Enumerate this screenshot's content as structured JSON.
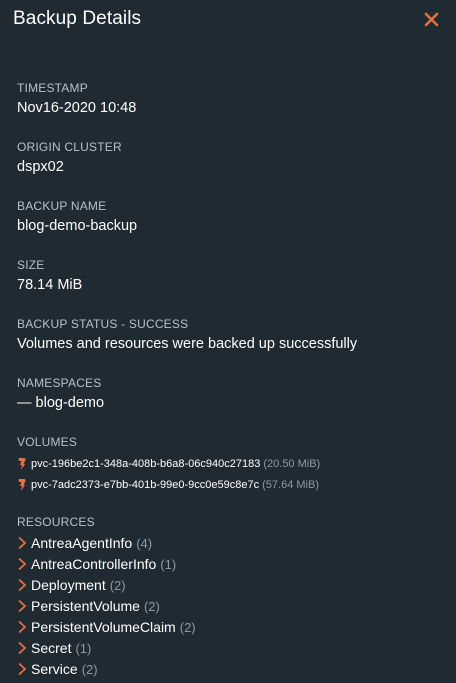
{
  "header": {
    "title": "Backup Details",
    "close_icon": "close-icon",
    "accent": "#e8703a"
  },
  "fields": {
    "timestamp_label": "TIMESTAMP",
    "timestamp_value": "Nov16-2020 10:48",
    "origin_label": "ORIGIN CLUSTER",
    "origin_value": "dspx02",
    "name_label": "BACKUP NAME",
    "name_value": "blog-demo-backup",
    "size_label": "SIZE",
    "size_value": "78.14 MiB",
    "status_label": "BACKUP STATUS - SUCCESS",
    "status_value": "Volumes and resources were backed up successfully",
    "namespaces_label": "NAMESPACES",
    "namespaces_value": "— blog-demo"
  },
  "volumes": {
    "label": "VOLUMES",
    "icon": "volume-icon",
    "items": [
      {
        "name": "pvc-196be2c1-348a-408b-b6a8-06c940c27183",
        "size": "(20.50 MiB)"
      },
      {
        "name": "pvc-7adc2373-e7bb-401b-99e0-9cc0e59c8e7c",
        "size": "(57.64 MiB)"
      }
    ]
  },
  "resources": {
    "label": "RESOURCES",
    "icon": "chevron-right-icon",
    "items": [
      {
        "name": "AntreaAgentInfo",
        "count": "(4)"
      },
      {
        "name": "AntreaControllerInfo",
        "count": "(1)"
      },
      {
        "name": "Deployment",
        "count": "(2)"
      },
      {
        "name": "PersistentVolume",
        "count": "(2)"
      },
      {
        "name": "PersistentVolumeClaim",
        "count": "(2)"
      },
      {
        "name": "Secret",
        "count": "(1)"
      },
      {
        "name": "Service",
        "count": "(2)"
      }
    ]
  }
}
